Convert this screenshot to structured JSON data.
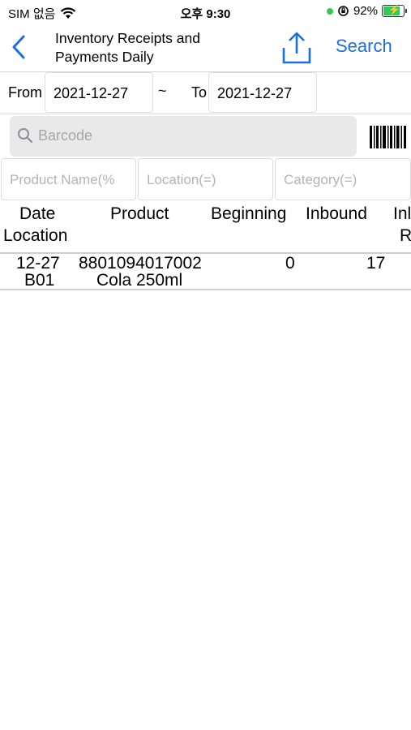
{
  "status_bar": {
    "carrier": "SIM 없음",
    "time": "오후 9:30",
    "battery": "92%",
    "battery_level": 0.92
  },
  "nav": {
    "back_icon": "chevron-left-icon",
    "title_line1": "Inventory Receipts and",
    "title_line2": "Payments Daily",
    "share_icon": "share-icon",
    "search_label": "Search",
    "accent_color": "#1a6fe0"
  },
  "date_filter": {
    "from_label": "From",
    "from_value": "2021-12-27",
    "separator": "~",
    "to_label": "To",
    "to_value": "2021-12-27"
  },
  "barcode": {
    "placeholder": "Barcode",
    "scan_icon": "barcode-icon"
  },
  "filters": {
    "product_placeholder": "Product Name(%",
    "location_placeholder": "Location(=)",
    "category_placeholder": "Category(=)"
  },
  "table": {
    "headers": {
      "date": "Date",
      "location": "Location",
      "product": "Product",
      "beginning": "Beginning",
      "inbound": "Inbound",
      "inbound_partial_1": "Inl",
      "inbound_partial_2": "R"
    },
    "rows": [
      {
        "date": "12-27",
        "location": "B01",
        "product_code": "8801094017002",
        "product_name": "Cola 250ml",
        "beginning": "0",
        "inbound": "17"
      }
    ]
  }
}
